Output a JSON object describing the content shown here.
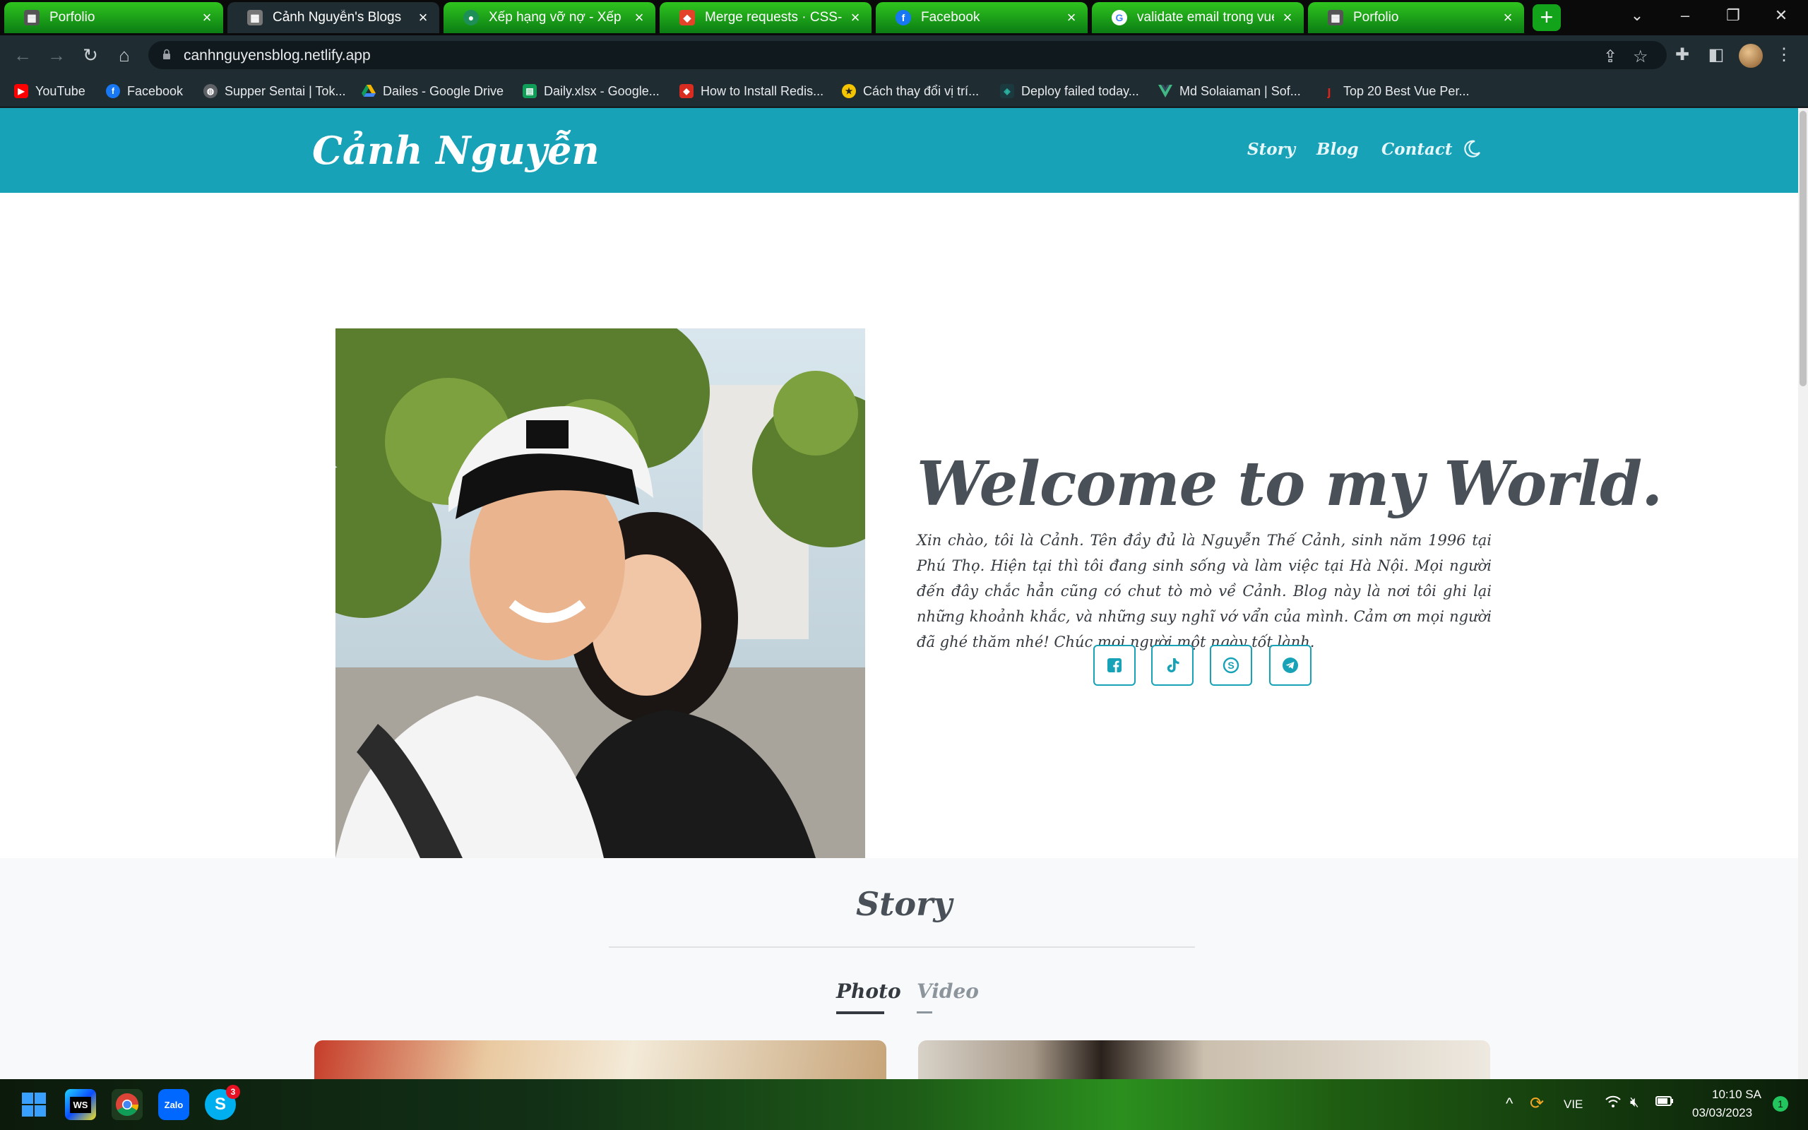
{
  "browser": {
    "tabs": [
      {
        "title": "Porfolio",
        "state": "inactive",
        "icon": "portfolio-favicon"
      },
      {
        "title": "Cảnh Nguyễn's Blogs",
        "state": "active",
        "icon": "blog-favicon"
      },
      {
        "title": "Xếp hạng vỡ nợ - Xếp hạn",
        "state": "inactive",
        "icon": "page-favicon"
      },
      {
        "title": "Merge requests · CSS-TPB",
        "state": "inactive",
        "icon": "gitlab-favicon"
      },
      {
        "title": "Facebook",
        "state": "inactive",
        "icon": "facebook-favicon"
      },
      {
        "title": "validate email trong vue js",
        "state": "inactive",
        "icon": "google-favicon"
      },
      {
        "title": "Porfolio",
        "state": "inactive",
        "icon": "portfolio-favicon"
      }
    ],
    "url": "canhnguyensblog.netlify.app",
    "bookmarks": [
      {
        "label": "YouTube",
        "icon": "youtube-icon",
        "color": "#ff0000"
      },
      {
        "label": "Facebook",
        "icon": "facebook-icon",
        "color": "#1877f2"
      },
      {
        "label": "Supper Sentai | Tok...",
        "icon": "globe-icon",
        "color": "#5f6368"
      },
      {
        "label": "Dailes - Google Drive",
        "icon": "google-drive-icon",
        "color": "#f4b400"
      },
      {
        "label": "Daily.xlsx - Google...",
        "icon": "google-sheets-icon",
        "color": "#0f9d58"
      },
      {
        "label": "How to Install Redis...",
        "icon": "redis-icon",
        "color": "#d82c20"
      },
      {
        "label": "Cách thay đổi vị trí...",
        "icon": "page-icon",
        "color": "#f5c400"
      },
      {
        "label": "Deploy failed today...",
        "icon": "netlify-icon",
        "color": "#1b3a3f"
      },
      {
        "label": "Md Solaiaman | Sof...",
        "icon": "vue-icon",
        "color": "#41b883"
      },
      {
        "label": "Top 20 Best Vue Per...",
        "icon": "bookmark-icon",
        "color": "#e2231a"
      }
    ]
  },
  "site": {
    "brand": "Cảnh Nguyễn",
    "nav": [
      "Story",
      "Blog",
      "Contact"
    ],
    "theme_toggle_icon": "moon-icon",
    "accent": "#17a2b8",
    "hero": {
      "heading": "Welcome to my World.",
      "intro": "Xin chào, tôi là Cảnh. Tên đầy đủ là Nguyễn Thế Cảnh, sinh năm 1996 tại Phú Thọ. Hiện tại thì tôi đang sinh sống và làm việc tại Hà Nội. Mọi người đến đây chắc hẳn cũng có chut tò mò về Cảnh. Blog này là nơi tôi ghi lại những khoảnh khắc, và những suy nghĩ vớ vẩn của mình. Cảm ơn mọi người đã ghé thăm nhé! Chúc mọi người một ngày tốt lành.",
      "social": [
        "facebook-icon",
        "tiktok-icon",
        "skype-icon",
        "telegram-icon"
      ]
    },
    "story": {
      "title": "Story",
      "tabs": [
        {
          "label": "Photo",
          "active": true
        },
        {
          "label": "Video",
          "active": false
        }
      ]
    }
  },
  "taskbar": {
    "apps": [
      {
        "name": "start-icon"
      },
      {
        "name": "webstorm-icon",
        "label": "WS"
      },
      {
        "name": "chrome-icon"
      },
      {
        "name": "zalo-icon",
        "label": "Zalo"
      },
      {
        "name": "skype-icon",
        "label": "S",
        "badge": "3"
      }
    ],
    "language": "VIE",
    "time": "10:10 SA",
    "date": "03/03/2023",
    "notifications": "1"
  }
}
